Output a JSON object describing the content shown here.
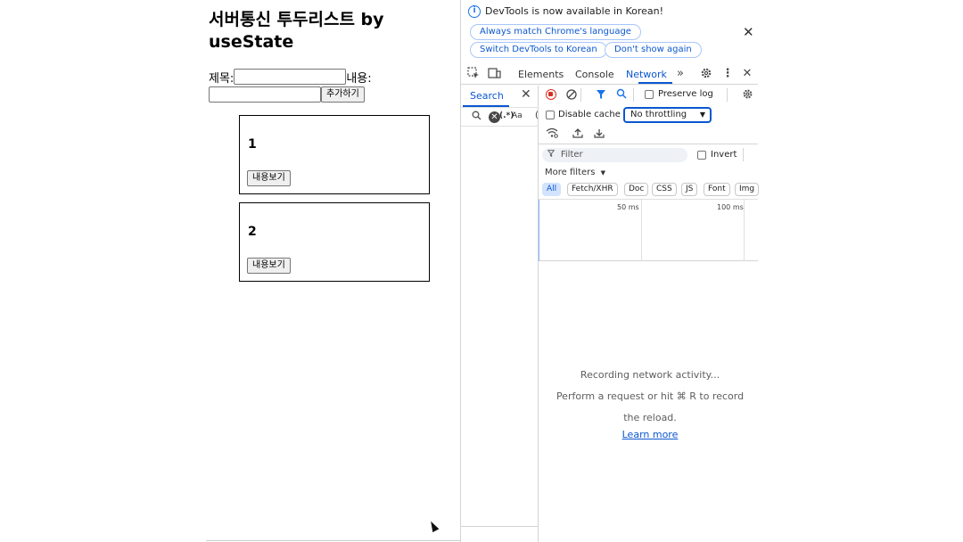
{
  "app": {
    "title": "서버통신 투두리스트 by useState",
    "form": {
      "title_label": "제목:",
      "title_value": "",
      "content_label": "내용:",
      "content_value": "",
      "add_button": "추가하기"
    },
    "todos": [
      {
        "title": "1",
        "button": "내용보기"
      },
      {
        "title": "2",
        "button": "내용보기"
      }
    ]
  },
  "devtools": {
    "infobar": {
      "message": "DevTools is now available in Korean!",
      "btn_match": "Always match Chrome's language",
      "btn_switch": "Switch DevTools to Korean",
      "btn_dont_show": "Don't show again"
    },
    "tabs": {
      "elements": "Elements",
      "console": "Console",
      "network": "Network",
      "active": "Network"
    },
    "search_pane": {
      "tab": "Search",
      "regex": "(.*)",
      "case": "Aa"
    },
    "network": {
      "preserve_log": "Preserve log",
      "disable_cache": "Disable cache",
      "throttling": "No throttling",
      "filter_placeholder": "Filter",
      "invert": "Invert",
      "more_filters": "More filters",
      "types": [
        "All",
        "Fetch/XHR",
        "Doc",
        "CSS",
        "JS",
        "Font",
        "Img"
      ],
      "timeline": {
        "t1": "50 ms",
        "t2": "100 ms"
      },
      "empty": {
        "line1": "Recording network activity...",
        "line2": "Perform a request or hit ⌘ R to record",
        "line3": "the reload.",
        "link": "Learn more"
      }
    }
  }
}
